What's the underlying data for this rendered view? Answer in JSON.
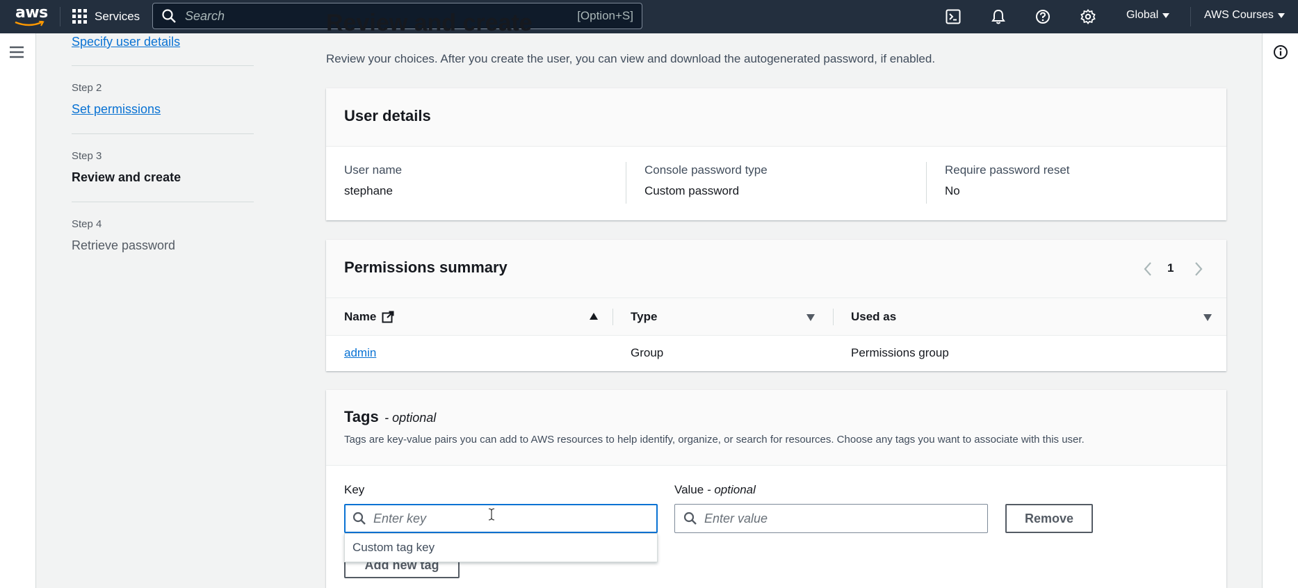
{
  "topnav": {
    "logo_text": "aws",
    "services_label": "Services",
    "search_placeholder": "Search",
    "search_shortcut": "[Option+S]",
    "icons": [
      "cloudshell-icon",
      "bell-icon",
      "help-icon",
      "gear-icon"
    ],
    "region_label": "Global",
    "account_label": "AWS Courses"
  },
  "steps": {
    "step1_link": "Specify user details",
    "step2_label": "Step 2",
    "step2_link": "Set permissions",
    "step3_label": "Step 3",
    "step3_title": "Review and create",
    "step4_label": "Step 4",
    "step4_title": "Retrieve password"
  },
  "page": {
    "title": "Review and create",
    "description": "Review your choices. After you create the user, you can view and download the autogenerated password, if enabled."
  },
  "user_details": {
    "title": "User details",
    "fields": [
      {
        "label": "User name",
        "value": "stephane"
      },
      {
        "label": "Console password type",
        "value": "Custom password"
      },
      {
        "label": "Require password reset",
        "value": "No"
      }
    ]
  },
  "permissions": {
    "title": "Permissions summary",
    "page_number": "1",
    "columns": [
      "Name",
      "Type",
      "Used as"
    ],
    "rows": [
      {
        "name": "admin",
        "type": "Group",
        "used_as": "Permissions group"
      }
    ]
  },
  "tags": {
    "title": "Tags",
    "title_suffix": "- optional",
    "description": "Tags are key-value pairs you can add to AWS resources to help identify, organize, or search for resources. Choose any tags you want to associate with this user.",
    "key_label": "Key",
    "key_placeholder": "Enter key",
    "value_label": "Value",
    "value_label_suffix": "- optional",
    "value_placeholder": "Enter value",
    "remove_label": "Remove",
    "dropdown_option": "Custom tag key",
    "add_label": "Add new tag"
  },
  "colors": {
    "nav_bg": "#232f3e",
    "link": "#0972d3",
    "accent_orange": "#ff9900"
  }
}
